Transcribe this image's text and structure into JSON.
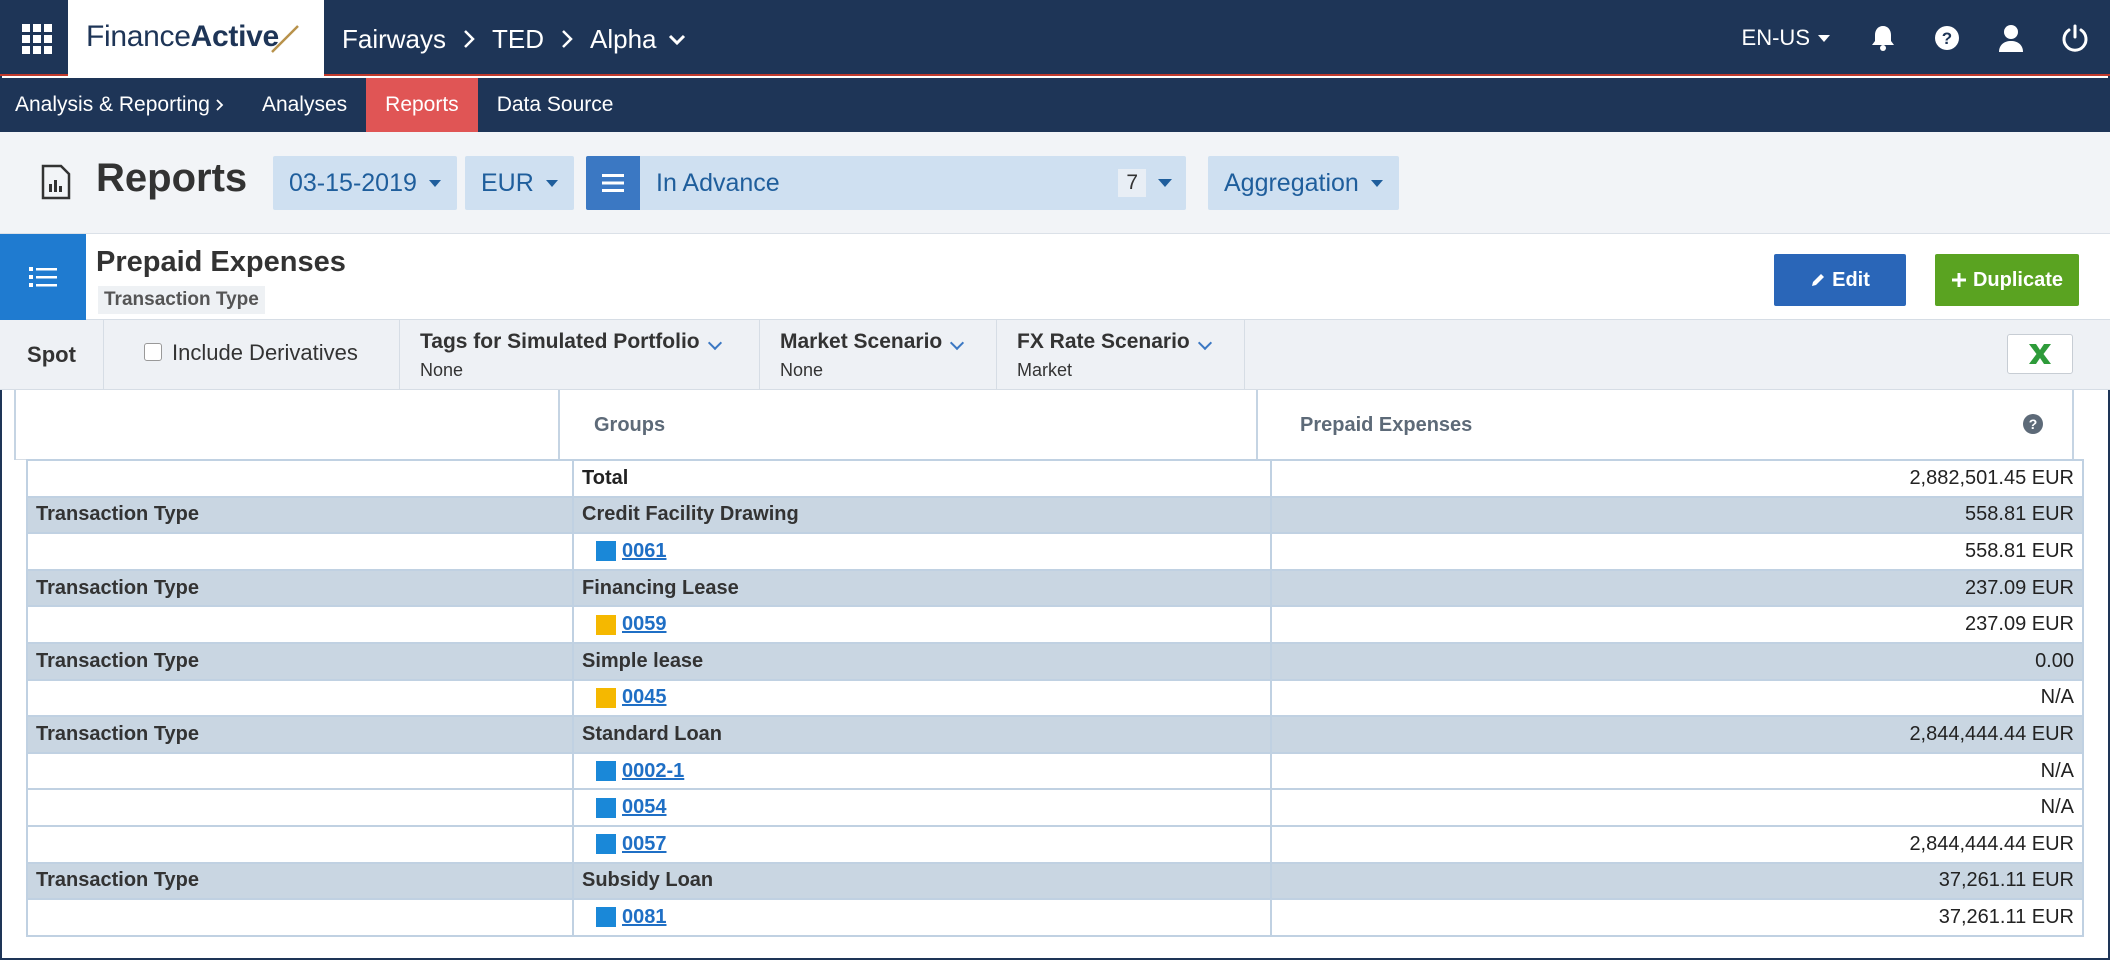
{
  "brand": {
    "name_regular": "Finance",
    "name_bold": "Active"
  },
  "breadcrumb": {
    "items": [
      "Fairways",
      "TED",
      "Alpha"
    ]
  },
  "topbar": {
    "language": "EN-US"
  },
  "subnav": {
    "section": "Analysis & Reporting",
    "items": [
      "Analyses",
      "Reports",
      "Data Source"
    ],
    "active": "Reports"
  },
  "report_header": {
    "title": "Reports",
    "date": "03-15-2019",
    "currency": "EUR",
    "selection_label": "In Advance",
    "selection_count": "7",
    "aggregation": "Aggregation"
  },
  "card": {
    "title": "Prepaid Expenses",
    "tag": "Transaction Type",
    "edit_label": "Edit",
    "duplicate_label": "Duplicate"
  },
  "filters": {
    "spot": "Spot",
    "include_derivatives": "Include Derivatives",
    "tags": {
      "label": "Tags for Simulated Portfolio",
      "value": "None"
    },
    "market": {
      "label": "Market Scenario",
      "value": "None"
    },
    "fx": {
      "label": "FX Rate Scenario",
      "value": "Market"
    }
  },
  "table": {
    "headers": {
      "groups": "Groups",
      "measure": "Prepaid Expenses"
    },
    "rows": [
      {
        "kind": "total",
        "level": "",
        "group": "Total",
        "value": "2,882,501.45 EUR"
      },
      {
        "kind": "group",
        "level": "Transaction Type",
        "group": "Credit Facility Drawing",
        "value": "558.81 EUR"
      },
      {
        "kind": "item",
        "id": "0061",
        "swatch": "#1a88d8",
        "value": "558.81 EUR"
      },
      {
        "kind": "group",
        "level": "Transaction Type",
        "group": "Financing Lease",
        "value": "237.09 EUR"
      },
      {
        "kind": "item",
        "id": "0059",
        "swatch": "#f5b800",
        "value": "237.09 EUR"
      },
      {
        "kind": "group",
        "level": "Transaction Type",
        "group": "Simple lease",
        "value": "0.00"
      },
      {
        "kind": "item",
        "id": "0045",
        "swatch": "#f5b800",
        "value": "N/A"
      },
      {
        "kind": "group",
        "level": "Transaction Type",
        "group": "Standard Loan",
        "value": "2,844,444.44 EUR"
      },
      {
        "kind": "item",
        "id": "0002-1",
        "swatch": "#1a88d8",
        "value": "N/A"
      },
      {
        "kind": "item",
        "id": "0054",
        "swatch": "#1a88d8",
        "value": "N/A"
      },
      {
        "kind": "item",
        "id": "0057",
        "swatch": "#1a88d8",
        "value": "2,844,444.44 EUR"
      },
      {
        "kind": "group",
        "level": "Transaction Type",
        "group": "Subsidy Loan",
        "value": "37,261.11 EUR"
      },
      {
        "kind": "item",
        "id": "0081",
        "swatch": "#1a88d8",
        "value": "37,261.11 EUR"
      }
    ]
  },
  "colors": {
    "nav_bg": "#1e3557",
    "active_tab": "#e05555",
    "edit_button": "#2a66b8",
    "duplicate_button": "#5aa321",
    "group_row": "#c9d6e2"
  }
}
